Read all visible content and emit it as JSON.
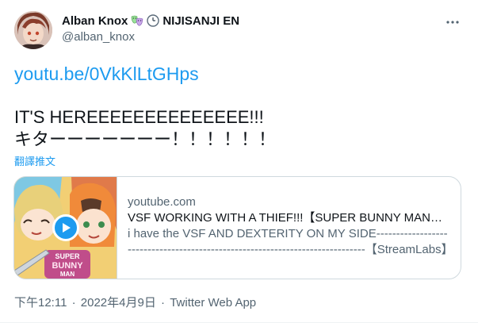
{
  "author": {
    "display_name": "Alban Knox",
    "affiliation": "NIJISANJI EN",
    "handle": "@alban_knox",
    "badge_icons": [
      "theater-masks-icon",
      "clock-icon"
    ]
  },
  "tweet": {
    "link_text": "youtu.be/0VkKlLtGHps",
    "lines": [
      "IT'S HEREEEEEEEEEEEEEE!!!",
      "キターーーーーーー！！！！！！"
    ],
    "translate_label": "翻譯推文"
  },
  "card": {
    "domain": "youtube.com",
    "title": "VSF WORKING WITH A THIEF!!!【SUPER BUNNY MAN】ft. Fulgur Ovid",
    "description": "i have the VSF AND DEXTERITY ON MY SIDE------------------------------------------------------------------------------【StreamLabs】",
    "thumbnail_logo_text": [
      "SUPER",
      "BUNNY",
      "MAN"
    ]
  },
  "meta": {
    "time": "下午12:11",
    "separator": "·",
    "date": "2022年4月9日",
    "source": "Twitter Web App"
  },
  "colors": {
    "accent": "#1d9bf0",
    "text_primary": "#0f1419",
    "text_secondary": "#536471",
    "border": "#cfd9de"
  }
}
